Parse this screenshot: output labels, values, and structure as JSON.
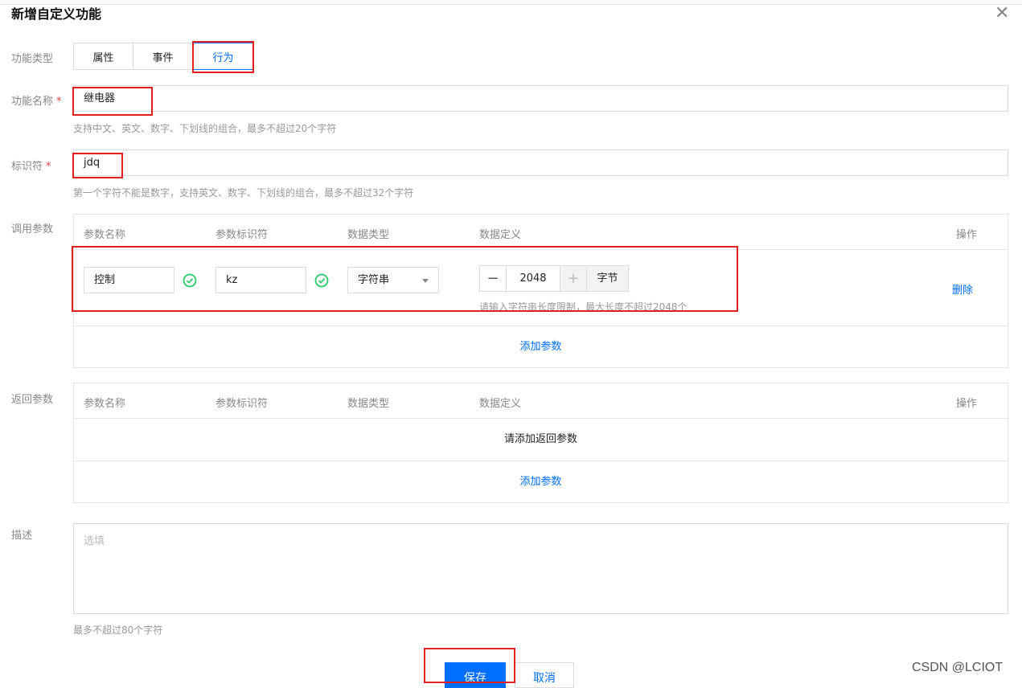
{
  "dialog": {
    "title": "新增自定义功能"
  },
  "type_field": {
    "label": "功能类型",
    "options": [
      "属性",
      "事件",
      "行为"
    ],
    "selected": "行为"
  },
  "name_field": {
    "label": "功能名称",
    "required_mark": "*",
    "value": "继电器",
    "hint": "支持中文、英文、数字、下划线的组合，最多不超过20个字符"
  },
  "identifier_field": {
    "label": "标识符",
    "required_mark": "*",
    "value": "jdq",
    "hint": "第一个字符不能是数字，支持英文、数字、下划线的组合，最多不超过32个字符"
  },
  "input_params": {
    "label": "调用参数",
    "columns": [
      "参数名称",
      "参数标识符",
      "数据类型",
      "数据定义",
      "操作"
    ],
    "rows": [
      {
        "name": "控制",
        "identifier": "kz",
        "data_type": "字符串",
        "length": "2048",
        "unit": "字节",
        "length_hint": "请输入字符串长度限制，最大长度不超过2048个",
        "action": "删除"
      }
    ],
    "add_label": "添加参数"
  },
  "output_params": {
    "label": "返回参数",
    "columns": [
      "参数名称",
      "参数标识符",
      "数据类型",
      "数据定义",
      "操作"
    ],
    "empty_text": "请添加返回参数",
    "add_label": "添加参数"
  },
  "description": {
    "label": "描述",
    "placeholder": "选填",
    "hint": "最多不超过80个字符"
  },
  "footer": {
    "save_label": "保存",
    "cancel_label": "取消"
  },
  "watermark": "CSDN @LCIOT",
  "colors": {
    "accent": "#006eff",
    "success": "#29cc6a",
    "annotation": "#e0201e",
    "required": "#e54545"
  },
  "icons": {
    "close": "close-icon",
    "check": "check-circle-icon",
    "dropdown": "chevron-down-icon",
    "minus": "minus-icon",
    "plus": "plus-icon"
  }
}
